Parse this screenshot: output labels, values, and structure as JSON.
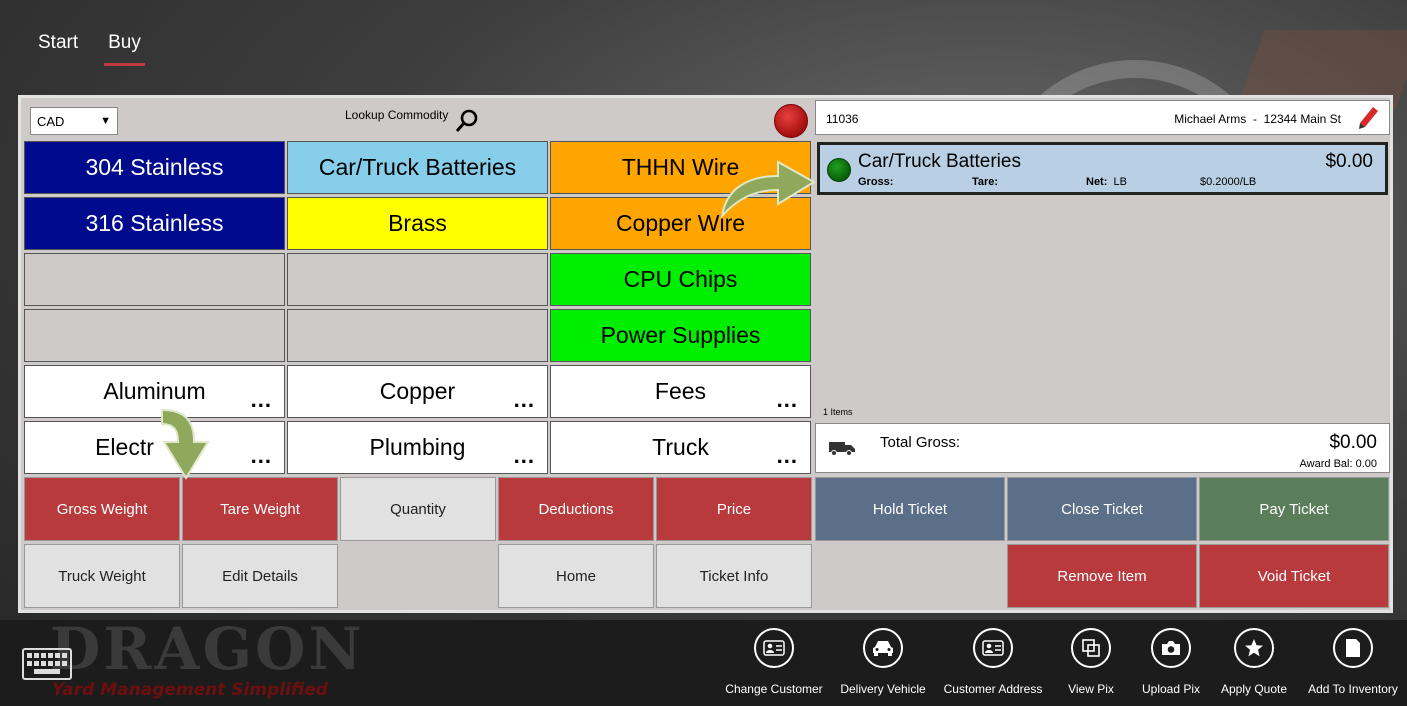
{
  "nav": {
    "tabs": [
      {
        "label": "Start"
      },
      {
        "label": "Buy"
      }
    ]
  },
  "toolbar": {
    "currency": "CAD",
    "lookup_label": "Lookup Commodity"
  },
  "commodities": {
    "r1": [
      "304 Stainless",
      "Car/Truck Batteries",
      "THHN Wire"
    ],
    "r2": [
      "316 Stainless",
      "Brass",
      "Copper Wire"
    ],
    "r3": [
      "CPU Chips"
    ],
    "r4": [
      "Power Supplies"
    ],
    "groups": [
      "Aluminum",
      "Copper",
      "Fees",
      "Electr",
      "Plumbing",
      "Truck"
    ],
    "more": "..."
  },
  "actions": {
    "gross_weight": "Gross Weight",
    "tare_weight": "Tare Weight",
    "quantity": "Quantity",
    "deductions": "Deductions",
    "price": "Price",
    "truck_weight": "Truck Weight",
    "edit_details": "Edit Details",
    "home": "Home",
    "ticket_info": "Ticket Info",
    "hold_ticket": "Hold Ticket",
    "close_ticket": "Close Ticket",
    "pay_ticket": "Pay Ticket",
    "remove_item": "Remove Item",
    "void_ticket": "Void Ticket"
  },
  "customer": {
    "account": "11036",
    "name": "Michael Arms",
    "separator": "-",
    "address": "12344 Main St"
  },
  "ticket_line": {
    "name": "Car/Truck Batteries",
    "price": "$0.00",
    "gross_label": "Gross:",
    "tare_label": "Tare:",
    "net_label": "Net:",
    "net_unit": "LB",
    "rate": "$0.2000/LB"
  },
  "items_count": "1  Items",
  "totals": {
    "label": "Total Gross:",
    "value": "$0.00",
    "award": "Award Bal:  0.00"
  },
  "brand": {
    "name": "DRAGON",
    "tagline": "Yard Management Simplified"
  },
  "appbar": [
    {
      "label": "Change Customer",
      "icon": "contact-card-icon"
    },
    {
      "label": "Delivery Vehicle",
      "icon": "car-icon"
    },
    {
      "label": "Customer Address",
      "icon": "contact-card-icon"
    },
    {
      "label": "View Pix",
      "icon": "copy-icon"
    },
    {
      "label": "Upload Pix",
      "icon": "camera-icon"
    },
    {
      "label": "Apply Quote",
      "icon": "star-icon"
    },
    {
      "label": "Add To Inventory",
      "icon": "page-icon"
    }
  ],
  "colors": {
    "accent_red": "#b83a3d",
    "hold_close": "#5b7088",
    "pay": "#5a7d5a",
    "navy": "#000a8c",
    "sky": "#87ceeb",
    "orange": "#ffa500",
    "yellow": "#ffff00",
    "green": "#00ee00"
  }
}
